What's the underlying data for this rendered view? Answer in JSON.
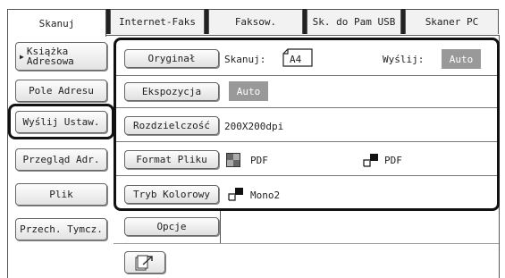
{
  "tabs": [
    {
      "label": "Skanuj",
      "active": true
    },
    {
      "label": "Internet-Faks"
    },
    {
      "label": "Faksow."
    },
    {
      "label": "Sk. do Pam USB"
    },
    {
      "label": "Skaner PC"
    }
  ],
  "sidebar": {
    "address_book": {
      "line1": "Książka",
      "line2": "Adresowa"
    },
    "items": [
      "Pole Adresu",
      "Wyślij Ustaw.",
      "Przegląd Adr.",
      "Plik",
      "Przech. Tymcz."
    ],
    "selected": "Wyślij Ustaw."
  },
  "main": {
    "original": {
      "label": "Oryginał",
      "scan_label": "Skanuj:",
      "scan_value": "A4",
      "send_label": "Wyślij:",
      "send_value": "Auto"
    },
    "exposure": {
      "label": "Ekspozycja",
      "value": "Auto"
    },
    "resolution": {
      "label": "Rozdzielczość",
      "value": "200X200dpi"
    },
    "file_format": {
      "label": "Format Pliku",
      "value1": "PDF",
      "value2": "PDF"
    },
    "color_mode": {
      "label": "Tryb Kolorowy",
      "value": "Mono2"
    },
    "options": {
      "label": "Opcje"
    }
  },
  "colors": {
    "auto_badge": "#999999",
    "outline": "#111111"
  }
}
